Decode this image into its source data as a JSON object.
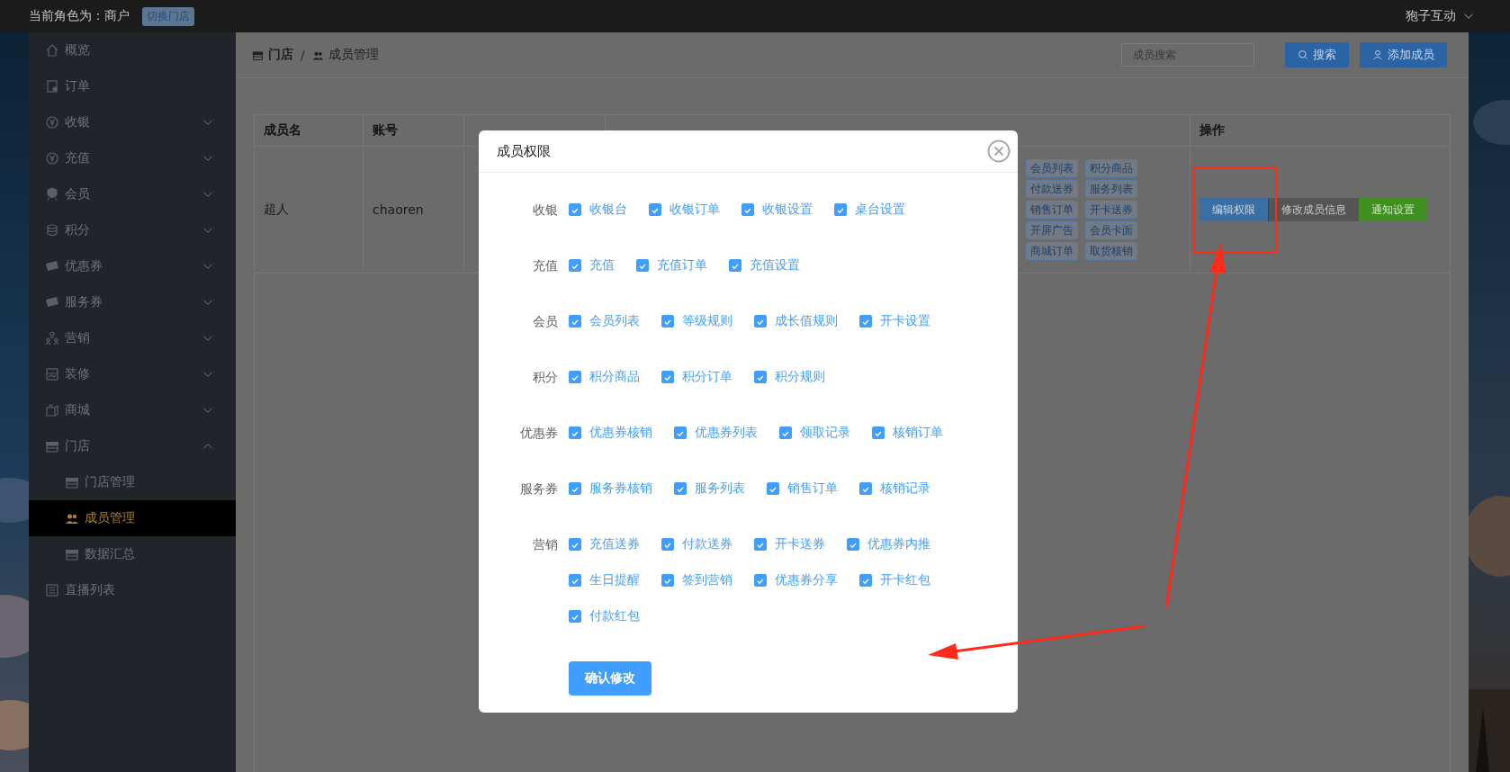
{
  "topbar": {
    "role_label": "当前角色为：商户",
    "switch_button": "切换门店",
    "account": "狍子互动"
  },
  "sidebar": {
    "items": [
      {
        "label": "概览",
        "kind": "link",
        "selected": false
      },
      {
        "label": "订单",
        "kind": "link",
        "selected": false
      },
      {
        "label": "收银",
        "kind": "group",
        "selected": false,
        "expanded": false
      },
      {
        "label": "充值",
        "kind": "group",
        "selected": false,
        "expanded": false
      },
      {
        "label": "会员",
        "kind": "group",
        "selected": false,
        "expanded": false
      },
      {
        "label": "积分",
        "kind": "group",
        "selected": false,
        "expanded": false
      },
      {
        "label": "优惠券",
        "kind": "group",
        "selected": false,
        "expanded": false
      },
      {
        "label": "服务券",
        "kind": "group",
        "selected": false,
        "expanded": false
      },
      {
        "label": "营销",
        "kind": "group",
        "selected": false,
        "expanded": false
      },
      {
        "label": "装修",
        "kind": "group",
        "selected": false,
        "expanded": false
      },
      {
        "label": "商城",
        "kind": "group",
        "selected": false,
        "expanded": false
      },
      {
        "label": "门店",
        "kind": "group",
        "selected": false,
        "expanded": true,
        "children": [
          {
            "label": "门店管理",
            "selected": false
          },
          {
            "label": "成员管理",
            "selected": true
          },
          {
            "label": "数据汇总",
            "selected": false
          }
        ]
      },
      {
        "label": "直播列表",
        "kind": "link",
        "selected": false
      }
    ]
  },
  "breadcrumb": {
    "items": [
      "门店",
      "成员管理"
    ],
    "separator": "/"
  },
  "search": {
    "placeholder": "成员搜索",
    "button": "搜索"
  },
  "add_button": "添加成员",
  "table": {
    "columns": {
      "name": "成员名",
      "account": "账号",
      "actions": "操作"
    },
    "rows": [
      {
        "name": "超人",
        "account": "chaoren",
        "permissions": [
          "会员列表",
          "积分商品",
          "付款送券",
          "服务列表",
          "销售订单",
          "开卡送券",
          "开屏广告",
          "会员卡面",
          "商城订单",
          "取货核销"
        ],
        "actions": [
          {
            "label": "编辑权限",
            "kind": "primary"
          },
          {
            "label": "修改成员信息",
            "kind": "default"
          },
          {
            "label": "通知设置",
            "kind": "success"
          }
        ]
      }
    ]
  },
  "modal": {
    "title": "成员权限",
    "groups": [
      {
        "label": "收银",
        "options": [
          {
            "label": "收银台",
            "checked": true
          },
          {
            "label": "收银订单",
            "checked": true
          },
          {
            "label": "收银设置",
            "checked": true
          },
          {
            "label": "桌台设置",
            "checked": true
          }
        ]
      },
      {
        "label": "充值",
        "options": [
          {
            "label": "充值",
            "checked": true
          },
          {
            "label": "充值订单",
            "checked": true
          },
          {
            "label": "充值设置",
            "checked": true
          }
        ]
      },
      {
        "label": "会员",
        "options": [
          {
            "label": "会员列表",
            "checked": true
          },
          {
            "label": "等级规则",
            "checked": true
          },
          {
            "label": "成长值规则",
            "checked": true
          },
          {
            "label": "开卡设置",
            "checked": true
          }
        ]
      },
      {
        "label": "积分",
        "options": [
          {
            "label": "积分商品",
            "checked": true
          },
          {
            "label": "积分订单",
            "checked": true
          },
          {
            "label": "积分规则",
            "checked": true
          }
        ]
      },
      {
        "label": "优惠券",
        "options": [
          {
            "label": "优惠券核销",
            "checked": true
          },
          {
            "label": "优惠券列表",
            "checked": true
          },
          {
            "label": "领取记录",
            "checked": true
          },
          {
            "label": "核销订单",
            "checked": true
          }
        ]
      },
      {
        "label": "服务券",
        "options": [
          {
            "label": "服务券核销",
            "checked": true
          },
          {
            "label": "服务列表",
            "checked": true
          },
          {
            "label": "销售订单",
            "checked": true
          },
          {
            "label": "核销记录",
            "checked": true
          }
        ]
      },
      {
        "label": "营销",
        "options": [
          {
            "label": "充值送券",
            "checked": true
          },
          {
            "label": "付款送券",
            "checked": true
          },
          {
            "label": "开卡送券",
            "checked": true
          },
          {
            "label": "优惠券内推",
            "checked": true
          },
          {
            "label": "生日提醒",
            "checked": true
          },
          {
            "label": "签到营销",
            "checked": true
          },
          {
            "label": "优惠券分享",
            "checked": true
          },
          {
            "label": "开卡红包",
            "checked": true
          },
          {
            "label": "付款红包",
            "checked": true
          }
        ]
      }
    ],
    "confirm_button": "确认修改"
  }
}
